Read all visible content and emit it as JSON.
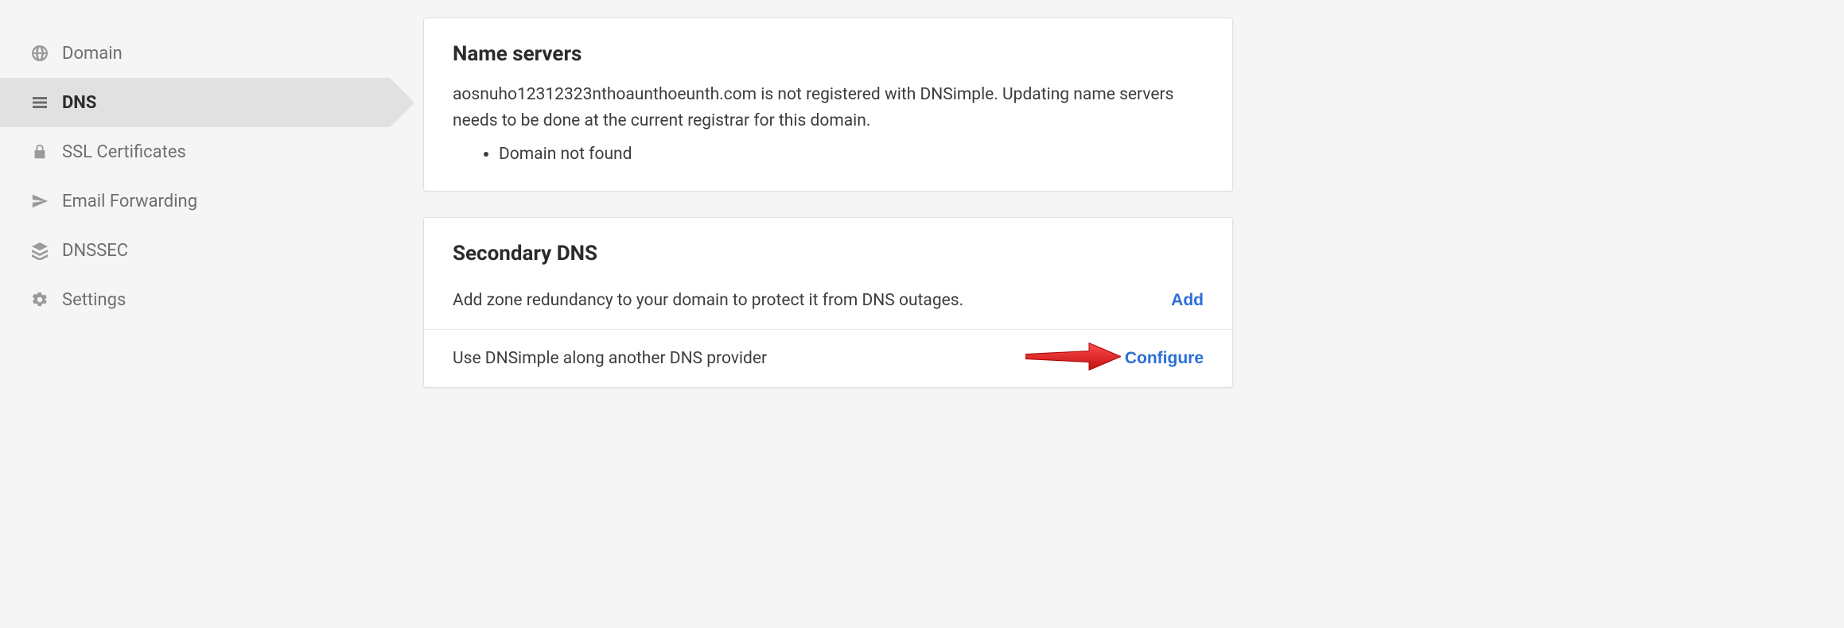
{
  "sidebar": {
    "items": [
      {
        "label": "Domain"
      },
      {
        "label": "DNS"
      },
      {
        "label": "SSL Certificates"
      },
      {
        "label": "Email Forwarding"
      },
      {
        "label": "DNSSEC"
      },
      {
        "label": "Settings"
      }
    ]
  },
  "nameservers": {
    "title": "Name servers",
    "body": "aosnuho12312323nthoaunthoeunth.com is not registered with DNSimple. Updating name servers needs to be done at the current registrar for this domain.",
    "bullets": [
      "Domain not found"
    ]
  },
  "secondary": {
    "title": "Secondary DNS",
    "rows": [
      {
        "text": "Add zone redundancy to your domain to protect it from DNS outages.",
        "action": "Add"
      },
      {
        "text": "Use DNSimple along another DNS provider",
        "action": "Configure"
      }
    ]
  }
}
